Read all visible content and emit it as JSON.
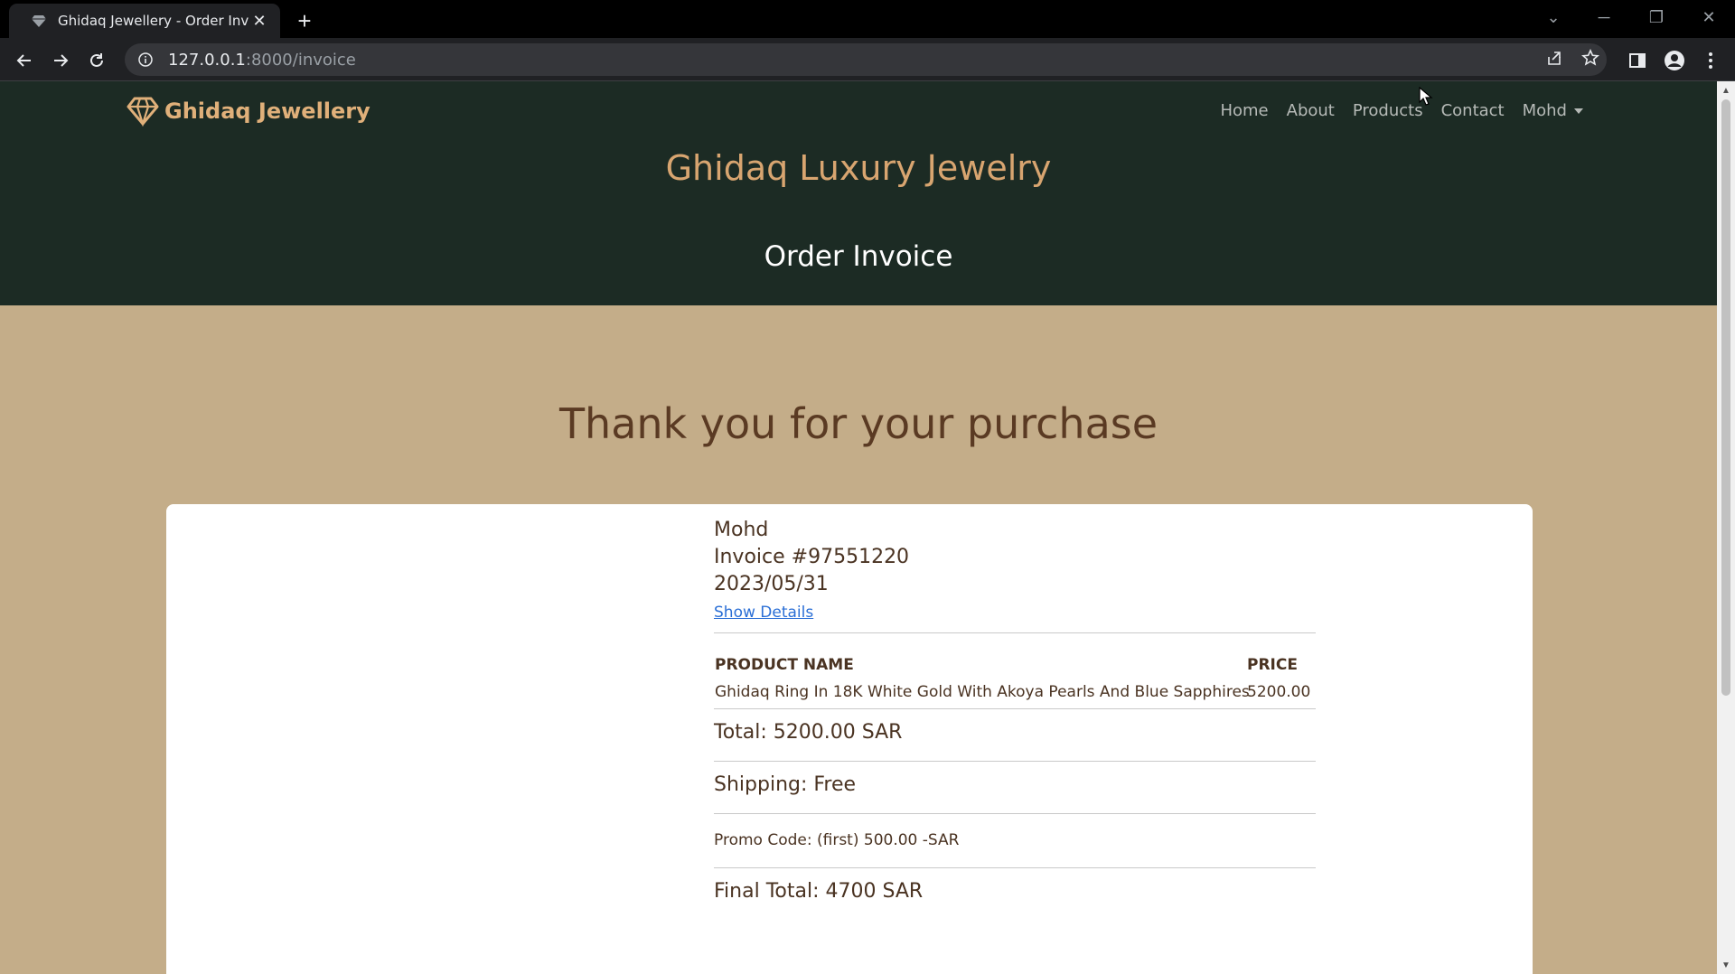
{
  "browser": {
    "tab_title": "Ghidaq Jewellery - Order Invoice",
    "url_host": "127.0.0.1",
    "url_path": ":8000/invoice"
  },
  "site": {
    "brand": "Ghidaq Jewellery",
    "nav": {
      "home": "Home",
      "about": "About",
      "products": "Products",
      "contact": "Contact",
      "user": "Mohd"
    },
    "title": "Ghidaq Luxury Jewelry",
    "page_title": "Order Invoice"
  },
  "main": {
    "thanks": "Thank you for your purchase",
    "invoice": {
      "customer": "Mohd",
      "number": "Invoice #97551220",
      "date": "2023/05/31",
      "details_link": "Show Details",
      "columns": {
        "product": "PRODUCT NAME",
        "price": "PRICE"
      },
      "items": [
        {
          "name": "Ghidaq Ring In 18K White Gold With Akoya Pearls And Blue Sapphires",
          "price": "5200.00"
        }
      ],
      "total": "Total: 5200.00 SAR",
      "shipping": "Shipping: Free",
      "promo": "Promo Code: (first) 500.00 -SAR",
      "final_total": "Final Total: 4700 SAR"
    }
  },
  "colors": {
    "header_bg": "#1c2b24",
    "page_bg": "#c4ad89",
    "accent": "#d8a570",
    "text_brown": "#5a3a23"
  }
}
